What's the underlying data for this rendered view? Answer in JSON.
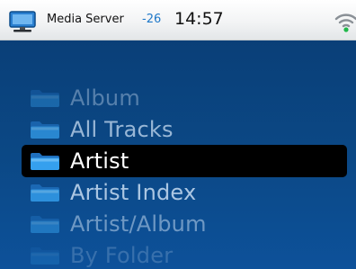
{
  "status_bar": {
    "app_icon": "computer-monitor-icon",
    "title": "Media Server",
    "signal": "-26",
    "time": "14:57",
    "wifi_icon": "wifi-icon"
  },
  "browse_list": {
    "folder_icon": "folder-icon",
    "items": [
      {
        "label": "Album",
        "selected": false
      },
      {
        "label": "All Tracks",
        "selected": false
      },
      {
        "label": "Artist",
        "selected": true
      },
      {
        "label": "Artist Index",
        "selected": false
      },
      {
        "label": "Artist/Album",
        "selected": false
      },
      {
        "label": "By Folder",
        "selected": false
      }
    ]
  },
  "colors": {
    "accent": "#1e78c8",
    "panel_top": "#0a3f78",
    "panel_bottom": "#0d519a",
    "selection": "#000000",
    "folder": "#2e8fe0"
  }
}
